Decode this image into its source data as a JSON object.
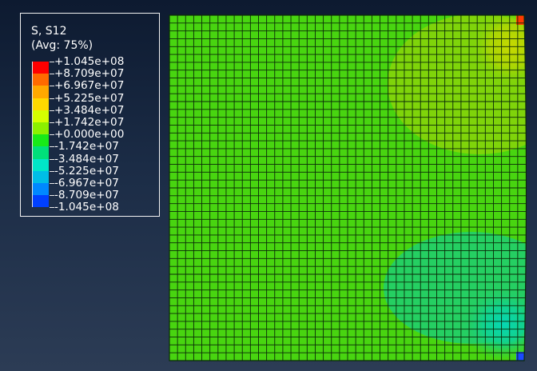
{
  "legend": {
    "title": "S, S12",
    "subtitle": "(Avg: 75%)",
    "labels": [
      "+1.045e+08",
      "+8.709e+07",
      "+6.967e+07",
      "+5.225e+07",
      "+3.484e+07",
      "+1.742e+07",
      "+0.000e+00",
      "-1.742e+07",
      "-3.484e+07",
      "-5.225e+07",
      "-6.967e+07",
      "-8.709e+07",
      "-1.045e+08"
    ],
    "colors": [
      "#ff0000",
      "#ff6a00",
      "#ffa800",
      "#ffd900",
      "#d6ff00",
      "#8cf000",
      "#18ea18",
      "#00e07a",
      "#00e6c8",
      "#00bde6",
      "#0088ff",
      "#0040ff"
    ]
  },
  "mesh": {
    "columns": 44,
    "rows": 44,
    "base_color": "#48d510",
    "line_color": "#0b2a08",
    "regions": [
      {
        "name": "upper-right-positive",
        "color": "#7fd40a"
      },
      {
        "name": "upper-right-peak",
        "color": "#c3d700"
      },
      {
        "name": "lower-right-negative",
        "color": "#25cf62"
      },
      {
        "name": "lower-right-trough",
        "color": "#06d6ad"
      },
      {
        "name": "top-right-corner",
        "color": "#ff3a00"
      },
      {
        "name": "bottom-right-corner",
        "color": "#0030ff"
      }
    ]
  }
}
